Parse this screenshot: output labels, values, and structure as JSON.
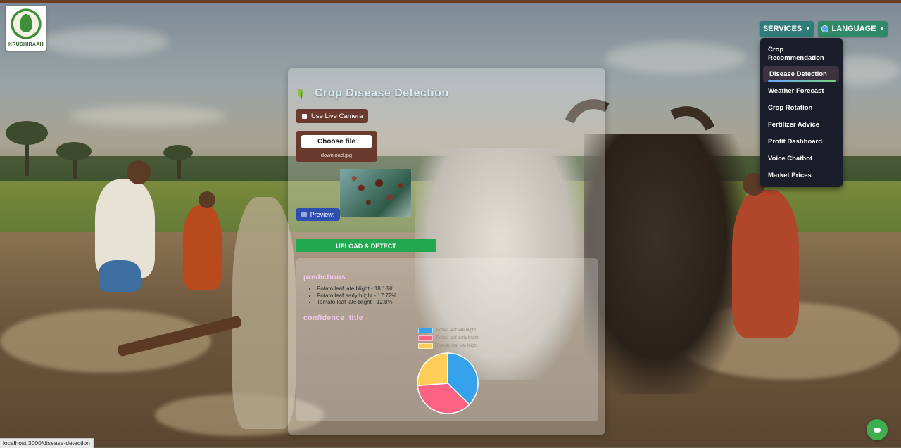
{
  "brand": {
    "name": "KRUSHIRAAH"
  },
  "nav": {
    "services_label": "SERVICES",
    "language_label": "LANGUAGE",
    "services_menu": [
      "Crop Recommendation",
      "Disease Detection",
      "Weather Forecast",
      "Crop Rotation",
      "Fertilizer Advice",
      "Profit Dashboard",
      "Voice Chatbot",
      "Market Prices"
    ],
    "active_item": "Disease Detection"
  },
  "page": {
    "title": "Crop Disease Detection",
    "camera_label": "Use Live Camera",
    "camera_checked": false,
    "choose_file_label": "Choose file",
    "file_name": "download.jpg",
    "preview_label": "Preview:",
    "upload_label": "UPLOAD & DETECT"
  },
  "results": {
    "predictions_heading": "predictions",
    "predictions": [
      "Potato leaf late blight - 18.18%",
      "Potato leaf early blight - 17.72%",
      "Tomato leaf late blight - 12.8%"
    ],
    "confidence_heading": "confidence_title"
  },
  "chart_data": {
    "type": "pie",
    "categories": [
      "Potato leaf late blight",
      "Potato leaf early blight",
      "Tomato leaf late blight"
    ],
    "values": [
      18.18,
      17.72,
      12.8
    ],
    "colors": [
      "#36a2eb",
      "#ff6384",
      "#ffce56"
    ],
    "legend_position": "top"
  },
  "status_bar": {
    "url": "localhost:3000/disease-detection"
  },
  "colors": {
    "services_button": "#2f7d7a",
    "language_button": "#2f8a68",
    "upload_button": "#22a84f",
    "preview_button": "#2f4fb0",
    "file_box": "#6a3a2e"
  }
}
